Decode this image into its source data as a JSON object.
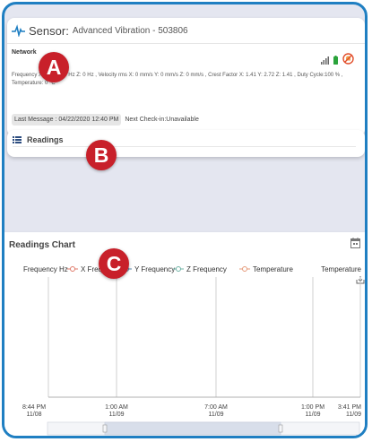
{
  "sensor": {
    "label": "Sensor:",
    "name": "Advanced Vibration - 503806",
    "network_label": "Network",
    "detail_text": "Frequency X: 0 Hz Y: 0 Hz Z: 0 Hz , Velocity rms X: 0 mm/s Y: 0 mm/s Z: 0 mm/s , Crest Factor X: 1.41 Y: 2.72 Z: 1.41 , Duty Cycle:100 % , Temperature: 0 °C",
    "last_message": "Last Message : 04/22/2020 12:40 PM",
    "next_checkin": "Next Check-in:Unavailable",
    "icons": [
      "pulse-icon",
      "signal-icon",
      "battery-icon",
      "no-notification-icon"
    ]
  },
  "readings": {
    "title": "Readings",
    "icon": "list-icon"
  },
  "chart": {
    "title": "Readings Chart",
    "left_axis_label": "Frequency  Hz",
    "right_axis_label": "Temperature",
    "calendar_icon": "calendar-icon",
    "download_icon": "download-icon"
  },
  "markers": {
    "a": "A",
    "b": "B",
    "c": "C"
  },
  "colors": {
    "accent": "#1f7fc2",
    "marker": "#c8202a",
    "x_series": "#e07a6a",
    "y_series": "#5a87a8",
    "z_series": "#6fb3a6",
    "temp_series": "#e59a7a"
  },
  "chart_data": {
    "type": "line",
    "series": [
      {
        "name": "X Frequency",
        "values": []
      },
      {
        "name": "Y Frequency",
        "values": []
      },
      {
        "name": "Z Frequency",
        "values": []
      },
      {
        "name": "Temperature",
        "values": []
      }
    ],
    "x_ticks": [
      {
        "time": "8:44 PM",
        "date": "11/08"
      },
      {
        "time": "1:00 AM",
        "date": "11/09"
      },
      {
        "time": "7:00 AM",
        "date": "11/09"
      },
      {
        "time": "1:00 PM",
        "date": "11/09"
      },
      {
        "time": "3:41 PM",
        "date": "11/09"
      }
    ],
    "ylabel": "Frequency  Hz",
    "y2label": "Temperature",
    "legend_position": "top",
    "grid": "vertical"
  }
}
